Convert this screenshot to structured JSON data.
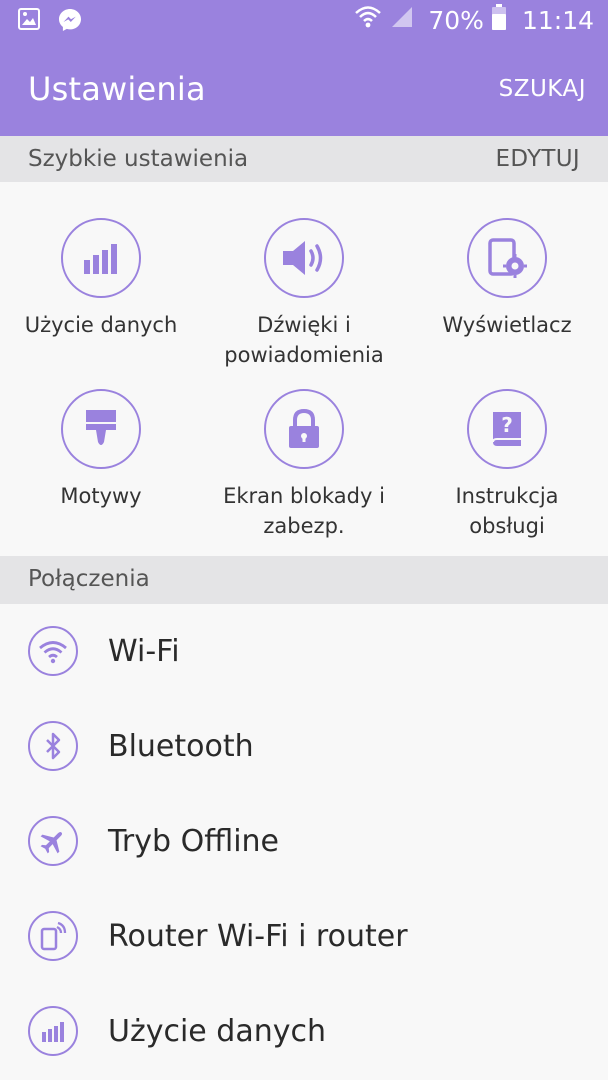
{
  "status_bar": {
    "battery_percent": "70%",
    "time": "11:14"
  },
  "app_bar": {
    "title": "Ustawienia",
    "search_label": "SZUKAJ"
  },
  "quick_settings": {
    "header": "Szybkie ustawienia",
    "edit_label": "EDYTUJ",
    "items": [
      {
        "label": "Użycie danych",
        "icon": "data-usage-icon"
      },
      {
        "label": "Dźwięki i\npowiadomienia",
        "icon": "speaker-icon"
      },
      {
        "label": "Wyświetlacz",
        "icon": "display-icon"
      },
      {
        "label": "Motywy",
        "icon": "paintbrush-icon"
      },
      {
        "label": "Ekran blokady i\nzabezp.",
        "icon": "lock-icon"
      },
      {
        "label": "Instrukcja\nobsługi",
        "icon": "help-book-icon"
      }
    ]
  },
  "connections": {
    "header": "Połączenia",
    "items": [
      {
        "label": "Wi-Fi",
        "icon": "wifi-icon"
      },
      {
        "label": "Bluetooth",
        "icon": "bluetooth-icon"
      },
      {
        "label": "Tryb Offline",
        "icon": "airplane-icon"
      },
      {
        "label": "Router Wi-Fi i router",
        "icon": "hotspot-icon"
      },
      {
        "label": "Użycie danych",
        "icon": "data-usage-icon"
      }
    ]
  },
  "colors": {
    "accent": "#9a82de",
    "section_bg": "#e4e4e6",
    "background": "#f8f8f8"
  }
}
